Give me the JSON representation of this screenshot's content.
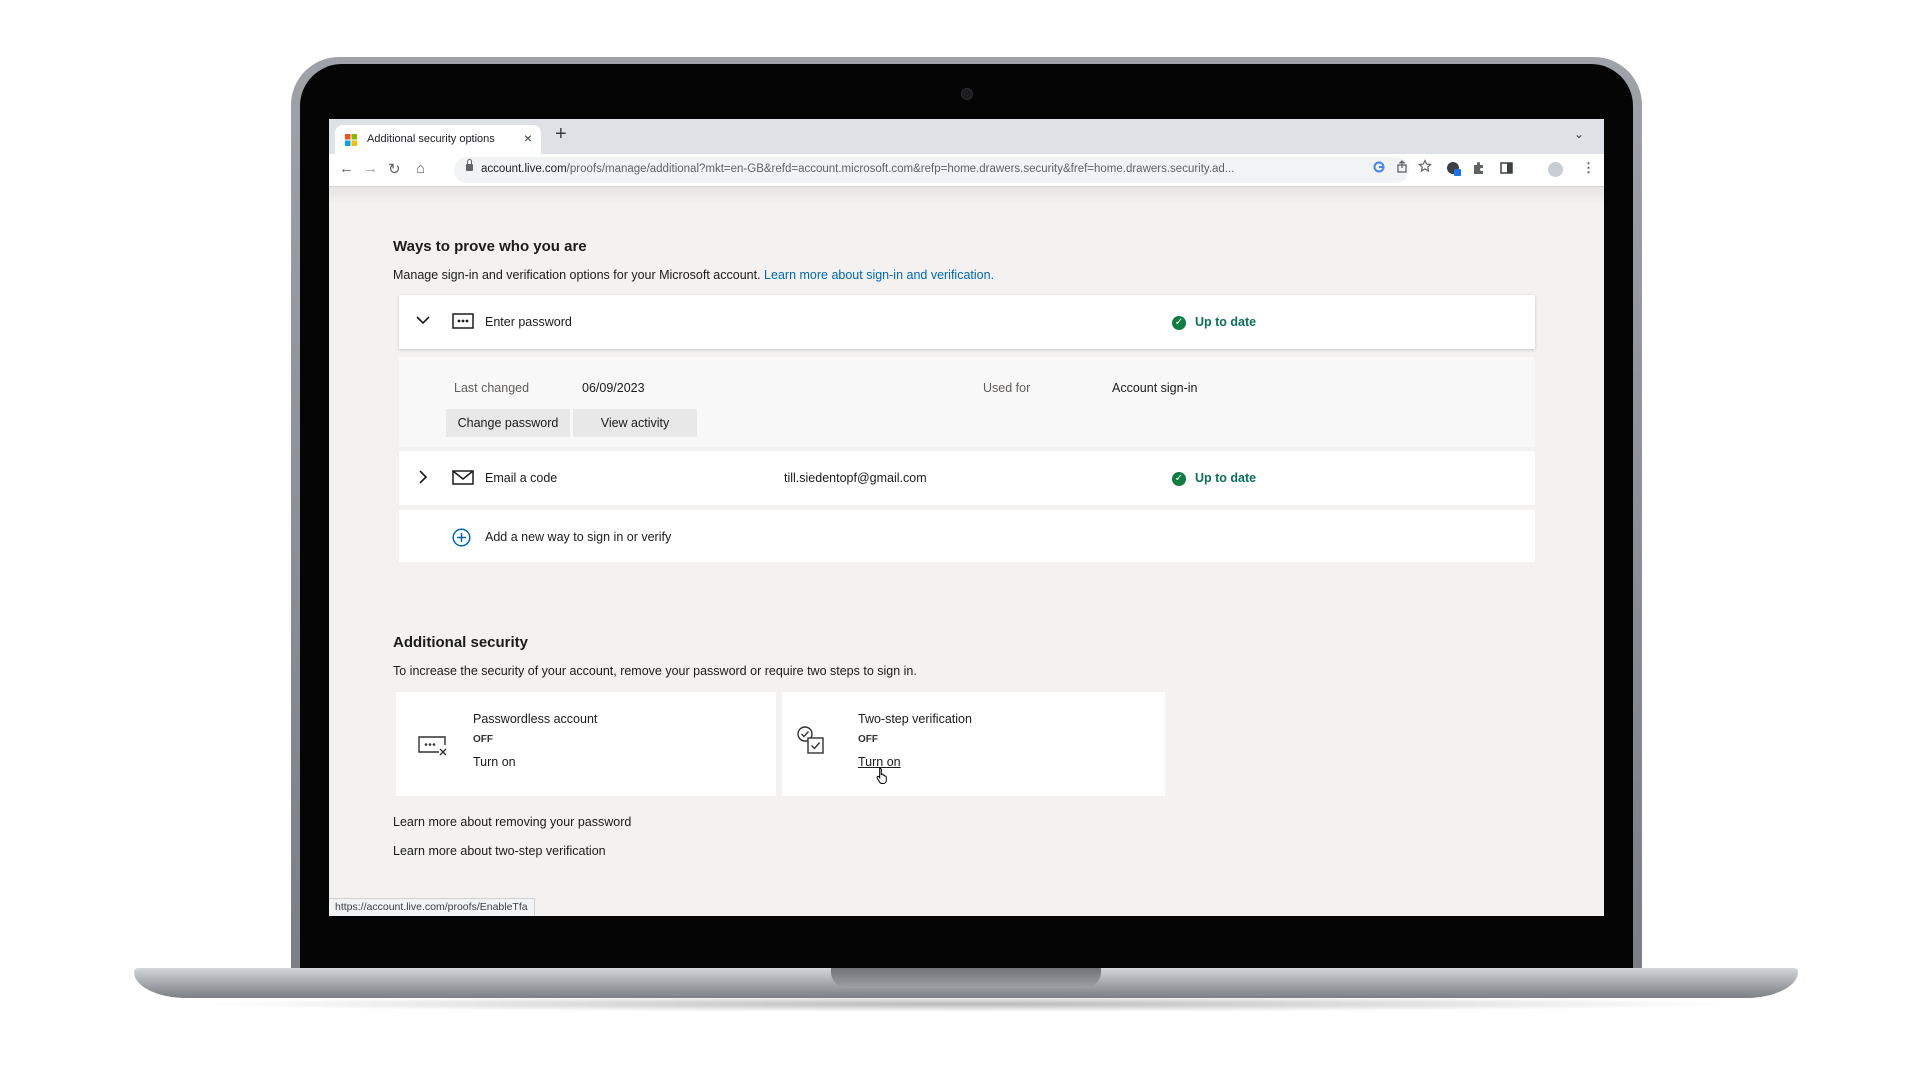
{
  "browser": {
    "tab_title": "Additional security options",
    "tab_close": "×",
    "new_tab": "+",
    "tab_list": "⌄",
    "url_host": "account.live.com",
    "url_path": "/proofs/manage/additional?mkt=en-GB&refd=account.microsoft.com&refp=home.drawers.security&fref=home.drawers.security.ad...",
    "nav": {
      "back": "←",
      "forward": "→",
      "reload": "↻",
      "home": "⌂"
    },
    "status_url": "https://account.live.com/proofs/EnableTfa"
  },
  "ways": {
    "title": "Ways to prove who you are",
    "description": "Manage sign-in and verification options for your Microsoft account.",
    "learn_link": "Learn more about sign-in and verification.",
    "password": {
      "label": "Enter password",
      "status": "Up to date",
      "last_changed_label": "Last changed",
      "last_changed_value": "06/09/2023",
      "used_for_label": "Used for",
      "used_for_value": "Account sign-in",
      "change_button": "Change password",
      "activity_button": "View activity"
    },
    "email": {
      "label": "Email a code",
      "address": "till.siedentopf@gmail.com",
      "status": "Up to date"
    },
    "add_new": "Add a new way to sign in or verify"
  },
  "additional": {
    "title": "Additional security",
    "description": "To increase the security of your account, remove your password or require two steps to sign in.",
    "passwordless": {
      "title": "Passwordless account",
      "state": "OFF",
      "action": "Turn on"
    },
    "two_step": {
      "title": "Two-step verification",
      "state": "OFF",
      "action": "Turn on"
    },
    "learn_remove": "Learn more about removing your password",
    "learn_two_step": "Learn more about two-step verification"
  },
  "colors": {
    "link": "#0067b8",
    "status_green": "#107c41",
    "page_bg": "#f3f2f1"
  }
}
